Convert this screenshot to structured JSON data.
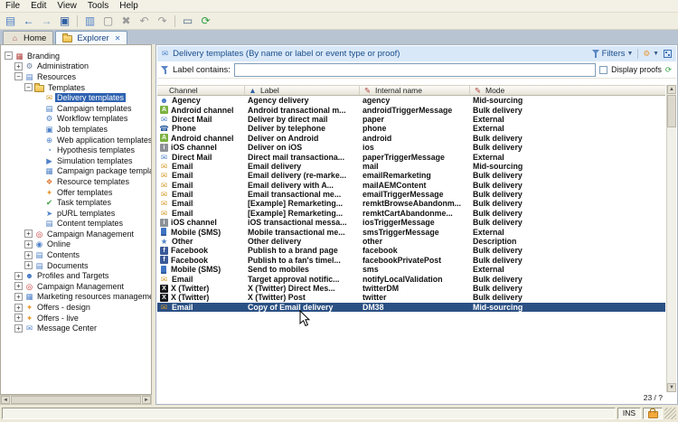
{
  "menu": {
    "items": [
      "File",
      "Edit",
      "View",
      "Tools",
      "Help"
    ]
  },
  "toolbar": {
    "items": [
      "new-document-icon",
      "back-icon",
      "forward-icon",
      "save-icon",
      "|",
      "copy-icon",
      "paste-icon",
      "delete-icon",
      "undo-icon",
      "redo-icon",
      "|",
      "print-icon",
      "refresh-toolbar-icon"
    ]
  },
  "tabs": {
    "tabs": [
      {
        "label": "Home",
        "icon": "home-icon",
        "active": false,
        "closable": false
      },
      {
        "label": "Explorer",
        "icon": "explorer-folder-icon",
        "active": true,
        "closable": true
      }
    ]
  },
  "tree": {
    "items": [
      {
        "label": "Branding",
        "level": 0,
        "exp": "-",
        "icon": "branding-icon",
        "sel": false
      },
      {
        "label": "Administration",
        "level": 1,
        "exp": "+",
        "icon": "administration-icon",
        "sel": false
      },
      {
        "label": "Resources",
        "level": 1,
        "exp": "-",
        "icon": "resources-icon",
        "sel": false
      },
      {
        "label": "Templates",
        "level": 2,
        "exp": "-",
        "icon": "templates-folder-icon",
        "sel": false
      },
      {
        "label": "Delivery templates",
        "level": 3,
        "exp": "",
        "icon": "delivery-templates-icon",
        "sel": true
      },
      {
        "label": "Campaign templates",
        "level": 3,
        "exp": "",
        "icon": "campaign-templates-icon",
        "sel": false
      },
      {
        "label": "Workflow templates",
        "level": 3,
        "exp": "",
        "icon": "workflow-templates-icon",
        "sel": false
      },
      {
        "label": "Job templates",
        "level": 3,
        "exp": "",
        "icon": "job-templates-icon",
        "sel": false
      },
      {
        "label": "Web application templates",
        "level": 3,
        "exp": "",
        "icon": "webapp-templates-icon",
        "sel": false
      },
      {
        "label": "Hypothesis templates",
        "level": 3,
        "exp": "",
        "icon": "hypothesis-templates-icon",
        "sel": false
      },
      {
        "label": "Simulation templates",
        "level": 3,
        "exp": "",
        "icon": "simulation-templates-icon",
        "sel": false
      },
      {
        "label": "Campaign package templates",
        "level": 3,
        "exp": "",
        "icon": "package-templates-icon",
        "sel": false
      },
      {
        "label": "Resource templates",
        "level": 3,
        "exp": "",
        "icon": "resource-templates-icon",
        "sel": false
      },
      {
        "label": "Offer templates",
        "level": 3,
        "exp": "",
        "icon": "offer-templates-icon",
        "sel": false
      },
      {
        "label": "Task templates",
        "level": 3,
        "exp": "",
        "icon": "task-templates-icon",
        "sel": false
      },
      {
        "label": "pURL templates",
        "level": 3,
        "exp": "",
        "icon": "purl-templates-icon",
        "sel": false
      },
      {
        "label": "Content templates",
        "level": 3,
        "exp": "",
        "icon": "content-templates-icon",
        "sel": false
      },
      {
        "label": "Campaign Management",
        "level": 2,
        "exp": "+",
        "icon": "campaign-management-icon",
        "sel": false
      },
      {
        "label": "Online",
        "level": 2,
        "exp": "+",
        "icon": "online-icon",
        "sel": false
      },
      {
        "label": "Contents",
        "level": 2,
        "exp": "+",
        "icon": "contents-icon",
        "sel": false
      },
      {
        "label": "Documents",
        "level": 2,
        "exp": "+",
        "icon": "documents-icon",
        "sel": false
      },
      {
        "label": "Profiles and Targets",
        "level": 1,
        "exp": "+",
        "icon": "profiles-icon",
        "sel": false
      },
      {
        "label": "Campaign Management",
        "level": 1,
        "exp": "+",
        "icon": "campaign-management-icon",
        "sel": false
      },
      {
        "label": "Marketing resources management",
        "level": 1,
        "exp": "+",
        "icon": "marketing-icon",
        "sel": false
      },
      {
        "label": "Offers - design",
        "level": 1,
        "exp": "+",
        "icon": "offers-design-icon",
        "sel": false
      },
      {
        "label": "Offers - live",
        "level": 1,
        "exp": "+",
        "icon": "offers-live-icon",
        "sel": false
      },
      {
        "label": "Message Center",
        "level": 1,
        "exp": "+",
        "icon": "message-center-icon",
        "sel": false
      }
    ]
  },
  "main": {
    "header": {
      "title": "Delivery templates (By name or label or event type or proof)",
      "filters_label": "Filters"
    },
    "filter": {
      "label": "Label contains:",
      "value": "",
      "display_proofs_label": "Display proofs"
    },
    "table": {
      "columns": [
        {
          "label": "Channel",
          "icon": ""
        },
        {
          "label": "Label",
          "icon": "sort-asc-icon"
        },
        {
          "label": "Internal name",
          "icon": "edit-col-icon"
        },
        {
          "label": "Mode",
          "icon": "edit-col-icon"
        }
      ],
      "rows": [
        {
          "icon": "agency-icon",
          "channel": "Agency",
          "label": "Agency delivery",
          "internal": "agency",
          "mode": "Mid-sourcing",
          "selected": false
        },
        {
          "icon": "android-icon",
          "channel": "Android channel",
          "label": "Android transactional m...",
          "internal": "androidTriggerMessage",
          "mode": "Bulk delivery",
          "selected": false
        },
        {
          "icon": "directmail-icon",
          "channel": "Direct Mail",
          "label": "Deliver by direct mail",
          "internal": "paper",
          "mode": "External",
          "selected": false
        },
        {
          "icon": "phone-icon",
          "channel": "Phone",
          "label": "Deliver by telephone",
          "internal": "phone",
          "mode": "External",
          "selected": false
        },
        {
          "icon": "android-icon",
          "channel": "Android channel",
          "label": "Deliver on Android",
          "internal": "android",
          "mode": "Bulk delivery",
          "selected": false
        },
        {
          "icon": "ios-icon",
          "channel": "iOS channel",
          "label": "Deliver on iOS",
          "internal": "ios",
          "mode": "Bulk delivery",
          "selected": false
        },
        {
          "icon": "directmail-icon",
          "channel": "Direct Mail",
          "label": "Direct mail transactiona...",
          "internal": "paperTriggerMessage",
          "mode": "External",
          "selected": false
        },
        {
          "icon": "email-icon",
          "channel": "Email",
          "label": "Email delivery",
          "internal": "mail",
          "mode": "Mid-sourcing",
          "selected": false
        },
        {
          "icon": "email-icon",
          "channel": "Email",
          "label": "Email delivery (re-marke...",
          "internal": "emailRemarketing",
          "mode": "Bulk delivery",
          "selected": false
        },
        {
          "icon": "email-icon",
          "channel": "Email",
          "label": "Email delivery with A...",
          "internal": "mailAEMContent",
          "mode": "Bulk delivery",
          "selected": false
        },
        {
          "icon": "email-icon",
          "channel": "Email",
          "label": "Email transactional me...",
          "internal": "emailTriggerMessage",
          "mode": "Bulk delivery",
          "selected": false
        },
        {
          "icon": "email-icon",
          "channel": "Email",
          "label": "[Example] Remarketing...",
          "internal": "remktBrowseAbandonm...",
          "mode": "Bulk delivery",
          "selected": false
        },
        {
          "icon": "email-icon",
          "channel": "Email",
          "label": "[Example] Remarketing...",
          "internal": "remktCartAbandonme...",
          "mode": "Bulk delivery",
          "selected": false
        },
        {
          "icon": "ios-icon",
          "channel": "iOS channel",
          "label": "iOS transactional messa...",
          "internal": "iosTriggerMessage",
          "mode": "Bulk delivery",
          "selected": false
        },
        {
          "icon": "mobile-icon",
          "channel": "Mobile (SMS)",
          "label": "Mobile transactional me...",
          "internal": "smsTriggerMessage",
          "mode": "External",
          "selected": false
        },
        {
          "icon": "other-icon",
          "channel": "Other",
          "label": "Other delivery",
          "internal": "other",
          "mode": "Description",
          "selected": false
        },
        {
          "icon": "facebook-icon",
          "channel": "Facebook",
          "label": "Publish to a brand page",
          "internal": "facebook",
          "mode": "Bulk delivery",
          "selected": false
        },
        {
          "icon": "facebook-icon",
          "channel": "Facebook",
          "label": "Publish to a fan's timel...",
          "internal": "facebookPrivatePost",
          "mode": "Bulk delivery",
          "selected": false
        },
        {
          "icon": "mobile-icon",
          "channel": "Mobile (SMS)",
          "label": "Send to mobiles",
          "internal": "sms",
          "mode": "External",
          "selected": false
        },
        {
          "icon": "email-icon",
          "channel": "Email",
          "label": "Target approval notific...",
          "internal": "notifyLocalValidation",
          "mode": "Bulk delivery",
          "selected": false
        },
        {
          "icon": "twitter-icon",
          "channel": "X (Twitter)",
          "label": "X (Twitter) Direct Mes...",
          "internal": "twitterDM",
          "mode": "Bulk delivery",
          "selected": false
        },
        {
          "icon": "twitter-icon",
          "channel": "X (Twitter)",
          "label": "X (Twitter) Post",
          "internal": "twitter",
          "mode": "Bulk delivery",
          "selected": false
        },
        {
          "icon": "email-icon",
          "channel": "Email",
          "label": "Copy of Email delivery",
          "internal": "DM38",
          "mode": "Mid-sourcing",
          "selected": true
        }
      ]
    },
    "record_count": "23 / ?"
  },
  "statusbar": {
    "ins": "INS"
  },
  "colors": {
    "selection_row": "#2b5083",
    "selection_tree": "#2e62b0",
    "panel_header_bg": "#d9e8f8",
    "accent_blue": "#1a4e8a"
  },
  "icons": {
    "new-document-icon": {
      "t": "g",
      "g": "▤",
      "c": "#4f81c7"
    },
    "back-icon": {
      "t": "g",
      "g": "←",
      "c": "#1f62b8"
    },
    "forward-icon": {
      "t": "g",
      "g": "→",
      "c": "#8aa3c0"
    },
    "save-icon": {
      "t": "g",
      "g": "▣",
      "c": "#2f5fa3"
    },
    "copy-icon": {
      "t": "g",
      "g": "▥",
      "c": "#4f81c7"
    },
    "paste-icon": {
      "t": "g",
      "g": "▢",
      "c": "#8a8a8a"
    },
    "delete-icon": {
      "t": "g",
      "g": "✖",
      "c": "#9a9a9a"
    },
    "undo-icon": {
      "t": "g",
      "g": "↶",
      "c": "#9a9a9a"
    },
    "redo-icon": {
      "t": "g",
      "g": "↷",
      "c": "#9a9a9a"
    },
    "print-icon": {
      "t": "g",
      "g": "▭",
      "c": "#4f6b8a"
    },
    "refresh-toolbar-icon": {
      "t": "g",
      "g": "⟳",
      "c": "#2e9e3e"
    },
    "home-icon": {
      "t": "g",
      "g": "⌂",
      "c": "#b0413e"
    },
    "explorer-folder-icon": {
      "t": "f"
    },
    "branding-icon": {
      "t": "g",
      "g": "▦",
      "c": "#b0413e"
    },
    "administration-icon": {
      "t": "g",
      "g": "⚙",
      "c": "#6b7f99"
    },
    "resources-icon": {
      "t": "g",
      "g": "▤",
      "c": "#4f81c7"
    },
    "templates-folder-icon": {
      "t": "f"
    },
    "delivery-templates-icon": {
      "t": "g",
      "g": "✉",
      "c": "#d29a2a"
    },
    "campaign-templates-icon": {
      "t": "g",
      "g": "▤",
      "c": "#4f81c7"
    },
    "workflow-templates-icon": {
      "t": "g",
      "g": "⚙",
      "c": "#4f81c7"
    },
    "job-templates-icon": {
      "t": "g",
      "g": "▣",
      "c": "#4f81c7"
    },
    "webapp-templates-icon": {
      "t": "g",
      "g": "⊕",
      "c": "#4f81c7"
    },
    "hypothesis-templates-icon": {
      "t": "g",
      "g": "◔",
      "c": "#4f81c7"
    },
    "simulation-templates-icon": {
      "t": "g",
      "g": "▶",
      "c": "#4f81c7"
    },
    "package-templates-icon": {
      "t": "g",
      "g": "▦",
      "c": "#4f81c7"
    },
    "resource-templates-icon": {
      "t": "g",
      "g": "❖",
      "c": "#e07b39"
    },
    "offer-templates-icon": {
      "t": "g",
      "g": "✦",
      "c": "#e8972e"
    },
    "task-templates-icon": {
      "t": "g",
      "g": "✔",
      "c": "#3f9e3f"
    },
    "purl-templates-icon": {
      "t": "g",
      "g": "➤",
      "c": "#4f81c7"
    },
    "content-templates-icon": {
      "t": "g",
      "g": "▤",
      "c": "#4f81c7"
    },
    "campaign-management-icon": {
      "t": "g",
      "g": "◎",
      "c": "#c23b3b"
    },
    "online-icon": {
      "t": "g",
      "g": "◉",
      "c": "#4f81c7"
    },
    "contents-icon": {
      "t": "g",
      "g": "▤",
      "c": "#4f81c7"
    },
    "documents-icon": {
      "t": "g",
      "g": "▤",
      "c": "#4f81c7"
    },
    "profiles-icon": {
      "t": "g",
      "g": "☻",
      "c": "#3f74c2"
    },
    "marketing-icon": {
      "t": "g",
      "g": "▦",
      "c": "#4f81c7"
    },
    "offers-design-icon": {
      "t": "g",
      "g": "✦",
      "c": "#e8972e"
    },
    "offers-live-icon": {
      "t": "g",
      "g": "✦",
      "c": "#e8972e"
    },
    "message-center-icon": {
      "t": "g",
      "g": "✉",
      "c": "#4f81c7"
    },
    "panel-title-icon": {
      "t": "g",
      "g": "✉",
      "c": "#4f81c7"
    },
    "gear-icon": {
      "t": "g",
      "g": "⚙",
      "c": "#e8972e"
    },
    "refresh-icon": {
      "t": "g",
      "g": "⟳",
      "c": "#2e9e3e"
    },
    "sort-asc-icon": {
      "t": "g",
      "g": "▲",
      "c": "#2f5fa3"
    },
    "edit-col-icon": {
      "t": "g",
      "g": "✎",
      "c": "#b0413e"
    },
    "agency-icon": {
      "t": "g",
      "g": "☻",
      "c": "#3f74c2"
    },
    "android-icon": {
      "t": "b",
      "g": "A",
      "bg": "#7cb342"
    },
    "directmail-icon": {
      "t": "g",
      "g": "✉",
      "c": "#4f81c7"
    },
    "phone-icon": {
      "t": "g",
      "g": "☎",
      "c": "#2f5fa3"
    },
    "ios-icon": {
      "t": "b",
      "g": "i",
      "bg": "#8d9298"
    },
    "email-icon": {
      "t": "g",
      "g": "✉",
      "c": "#d29a2a"
    },
    "mobile-icon": {
      "t": "p"
    },
    "other-icon": {
      "t": "g",
      "g": "★",
      "c": "#4f81c7"
    },
    "facebook-icon": {
      "t": "b",
      "g": "f",
      "bg": "#3b5998"
    },
    "twitter-icon": {
      "t": "b",
      "g": "X",
      "bg": "#14171a"
    }
  }
}
